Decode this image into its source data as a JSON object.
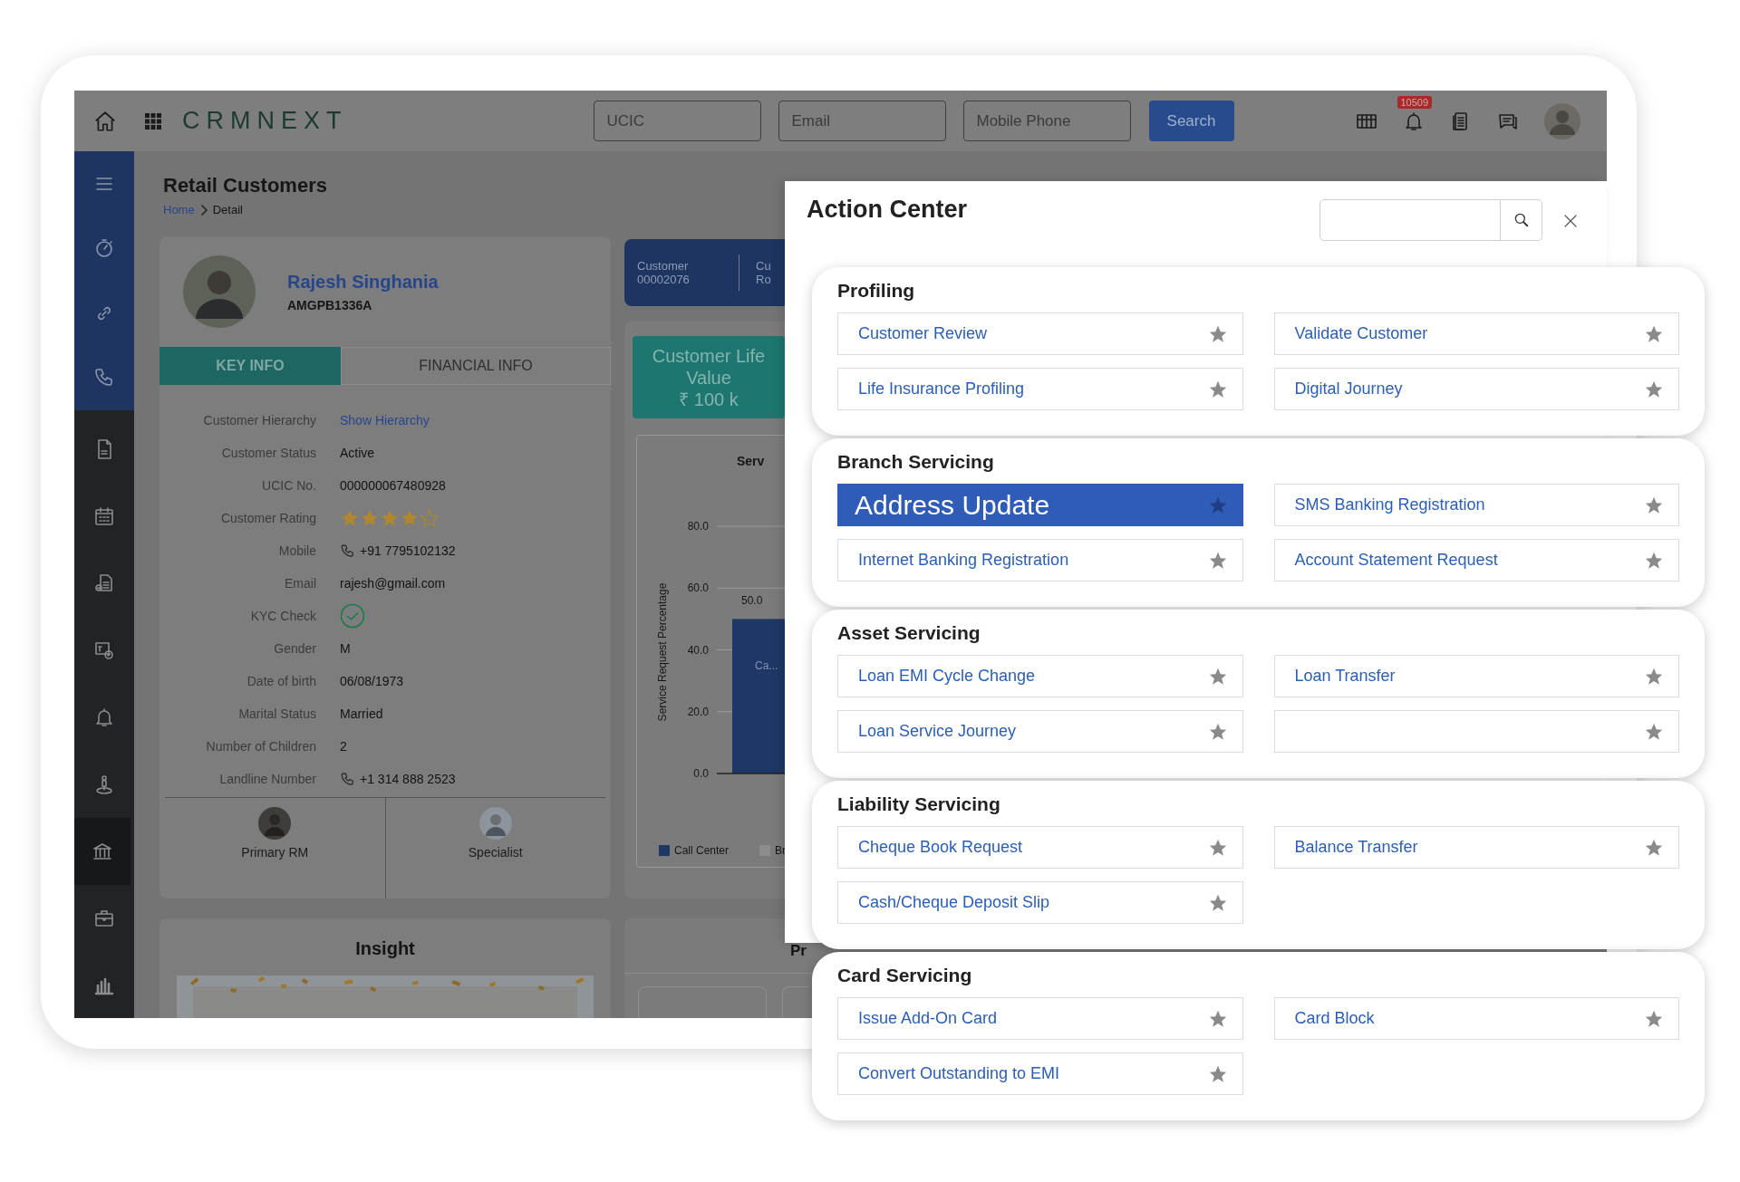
{
  "app_header": {
    "logo": "CRMNEXT",
    "search_fields": [
      {
        "placeholder": "UCIC"
      },
      {
        "placeholder": "Email"
      },
      {
        "placeholder": "Mobile Phone"
      }
    ],
    "search_button": "Search",
    "notification_badge": "10509"
  },
  "sidebar": {
    "groups": [
      {
        "kind": "accent",
        "items": [
          {
            "selected": false
          },
          {
            "selected": false
          },
          {
            "selected": false
          },
          {
            "selected": false
          }
        ]
      },
      {
        "kind": "plain",
        "items": [
          {
            "selected": false
          },
          {
            "selected": false
          },
          {
            "selected": false
          },
          {
            "selected": false
          },
          {
            "selected": false
          },
          {
            "selected": false
          },
          {
            "selected": true
          },
          {
            "selected": false
          },
          {
            "selected": false
          }
        ]
      }
    ]
  },
  "page": {
    "title": "Retail Customers",
    "breadcrumb": [
      {
        "label": "Home",
        "kind": "link"
      },
      {
        "label": "Detail",
        "kind": "current"
      }
    ]
  },
  "customer_card": {
    "name": "Rajesh Singhania",
    "code": "AMGPB1336A",
    "tabs": [
      {
        "label": "KEY INFO",
        "selected": true
      },
      {
        "label": "FINANCIAL INFO",
        "selected": false
      }
    ],
    "fields": [
      {
        "label": "Customer Hierarchy",
        "value": "Show Hierarchy",
        "kind": "link"
      },
      {
        "label": "Customer Status",
        "value": "Active",
        "kind": "text"
      },
      {
        "label": "UCIC No.",
        "value": "000000067480928",
        "kind": "text"
      },
      {
        "label": "Customer Rating",
        "kind": "rating",
        "stars": 4
      },
      {
        "label": "Mobile",
        "value": "+91 7795102132",
        "kind": "phone"
      },
      {
        "label": "Email",
        "value": "rajesh@gmail.com",
        "kind": "text"
      },
      {
        "label": "KYC Check",
        "kind": "check",
        "checked": true
      },
      {
        "label": "Gender",
        "value": "M",
        "kind": "text"
      },
      {
        "label": "Date of birth",
        "value": "06/08/1973",
        "kind": "text"
      },
      {
        "label": "Marital Status",
        "value": "Married",
        "kind": "text"
      },
      {
        "label": "Number of Children",
        "value": "2",
        "kind": "text"
      },
      {
        "label": "Landline Number",
        "value": "+1 314 888 2523",
        "kind": "phone"
      }
    ],
    "contacts": [
      {
        "role": "Primary RM"
      },
      {
        "role": "Specialist"
      }
    ]
  },
  "summary": [
    {
      "label": "Customer",
      "value": "00002076"
    },
    {
      "label": "Cu",
      "value": "Ro"
    }
  ],
  "lifetime_value": {
    "lines": [
      "Customer Life",
      "Value",
      "₹ 100 k"
    ]
  },
  "service_chart": {
    "chart_data": {
      "type": "bar",
      "title": "Serv",
      "ylabel": "Service Request Percentage",
      "categories": [
        "Ca..."
      ],
      "series": [
        {
          "name": "Call Center",
          "color": "#1f3765",
          "values": [
            50
          ]
        },
        {
          "name": "Br",
          "color": "#8c8c8c",
          "values": [
            null
          ]
        }
      ],
      "ylim": [
        0,
        80
      ],
      "yticks": [
        {
          "value": 0,
          "label": "0.0"
        },
        {
          "value": 20,
          "label": "20.0"
        },
        {
          "value": 40,
          "label": "40.0"
        },
        {
          "value": 60,
          "label": "60.0"
        },
        {
          "value": 80,
          "label": "80.0"
        }
      ],
      "grid": true,
      "value_labels": [
        [
          "50.0"
        ],
        [
          null
        ]
      ]
    }
  },
  "insight": {
    "title": "Insight"
  },
  "bottom_card": {
    "title": "Pr"
  },
  "action_center": {
    "title": "Action Center",
    "sections": [
      {
        "title": "Profiling",
        "items": [
          {
            "label": "Customer Review",
            "selected": false
          },
          {
            "label": "Validate Customer",
            "selected": false
          },
          {
            "label": "Life Insurance Profiling",
            "selected": false
          },
          {
            "label": "Digital Journey",
            "selected": false
          }
        ]
      },
      {
        "title": "Branch Servicing",
        "items": [
          {
            "label": "Address Update",
            "selected": true
          },
          {
            "label": "SMS Banking Registration",
            "selected": false
          },
          {
            "label": "Internet Banking Registration",
            "selected": false
          },
          {
            "label": "Account Statement Request",
            "selected": false
          }
        ]
      },
      {
        "title": "Asset Servicing",
        "items": [
          {
            "label": "Loan EMI Cycle Change",
            "selected": false
          },
          {
            "label": "Loan Transfer",
            "selected": false
          },
          {
            "label": "Loan Service Journey",
            "selected": false
          },
          {
            "selected": false
          }
        ]
      },
      {
        "title": "Liability Servicing",
        "items": [
          {
            "label": "Cheque Book Request",
            "selected": false
          },
          {
            "label": "Balance Transfer",
            "selected": false
          },
          {
            "label": "Cash/Cheque Deposit Slip",
            "selected": false
          }
        ]
      },
      {
        "title": "Card Servicing",
        "items": [
          {
            "label": "Issue Add-On Card",
            "selected": false
          },
          {
            "label": "Card Block",
            "selected": false
          },
          {
            "label": "Convert Outstanding to EMI",
            "selected": false
          }
        ]
      }
    ]
  }
}
